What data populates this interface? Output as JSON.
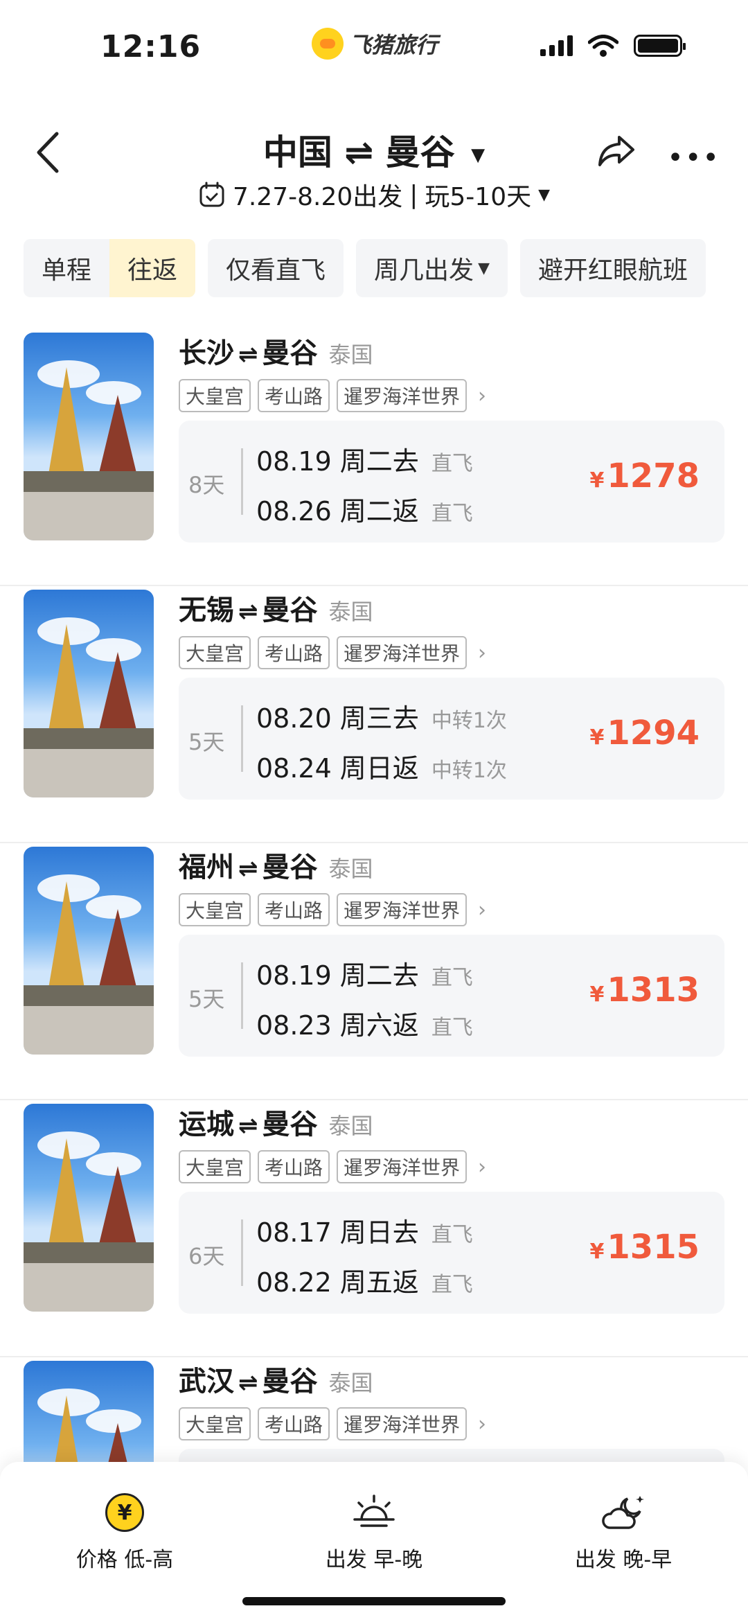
{
  "status_bar": {
    "time": "12:16",
    "app_name": "飞猪旅行",
    "icons": [
      "signal-icon",
      "wifi-icon",
      "battery-icon"
    ]
  },
  "header": {
    "from": "中国",
    "route_arrow": "⇌",
    "to": "曼谷",
    "dropdown_caret": "▼",
    "date_range": "7.27-8.20出发",
    "separator": "|",
    "trip_length": "玩5-10天",
    "sub_caret": "▼",
    "more_dots": "•••"
  },
  "filters": {
    "one_way": "单程",
    "round_trip": "往返",
    "direct_only": "仅看直飞",
    "weekday": "周几出发",
    "weekday_caret": "▼",
    "avoid_red_eye": "避开红眼航班"
  },
  "results": [
    {
      "origin": "长沙",
      "arrow": "⇌",
      "destination": "曼谷",
      "country": "泰国",
      "tags": [
        "大皇宫",
        "考山路",
        "暹罗海洋世界"
      ],
      "tag_more": "›",
      "days": "8天",
      "out_date": "08.19",
      "out_day": "周二去",
      "out_type": "直飞",
      "ret_date": "08.26",
      "ret_day": "周二返",
      "ret_type": "直飞",
      "currency": "¥",
      "price": "1278"
    },
    {
      "origin": "无锡",
      "arrow": "⇌",
      "destination": "曼谷",
      "country": "泰国",
      "tags": [
        "大皇宫",
        "考山路",
        "暹罗海洋世界"
      ],
      "tag_more": "›",
      "days": "5天",
      "out_date": "08.20",
      "out_day": "周三去",
      "out_type": "中转1次",
      "ret_date": "08.24",
      "ret_day": "周日返",
      "ret_type": "中转1次",
      "currency": "¥",
      "price": "1294"
    },
    {
      "origin": "福州",
      "arrow": "⇌",
      "destination": "曼谷",
      "country": "泰国",
      "tags": [
        "大皇宫",
        "考山路",
        "暹罗海洋世界"
      ],
      "tag_more": "›",
      "days": "5天",
      "out_date": "08.19",
      "out_day": "周二去",
      "out_type": "直飞",
      "ret_date": "08.23",
      "ret_day": "周六返",
      "ret_type": "直飞",
      "currency": "¥",
      "price": "1313"
    },
    {
      "origin": "运城",
      "arrow": "⇌",
      "destination": "曼谷",
      "country": "泰国",
      "tags": [
        "大皇宫",
        "考山路",
        "暹罗海洋世界"
      ],
      "tag_more": "›",
      "days": "6天",
      "out_date": "08.17",
      "out_day": "周日去",
      "out_type": "直飞",
      "ret_date": "08.22",
      "ret_day": "周五返",
      "ret_type": "直飞",
      "currency": "¥",
      "price": "1315"
    },
    {
      "origin": "武汉",
      "arrow": "⇌",
      "destination": "曼谷",
      "country": "泰国",
      "tags": [
        "大皇宫",
        "考山路",
        "暹罗海洋世界"
      ],
      "tag_more": "›"
    }
  ],
  "sort_bar": {
    "price_badge": "¥",
    "price_low_high": "价格 低-高",
    "depart_early_late": "出发 早-晚",
    "depart_late_early": "出发 晚-早"
  },
  "colors": {
    "accent_yellow": "#ffd21e",
    "active_chip_bg": "#fff4d0",
    "price_red": "#f05a3c"
  }
}
